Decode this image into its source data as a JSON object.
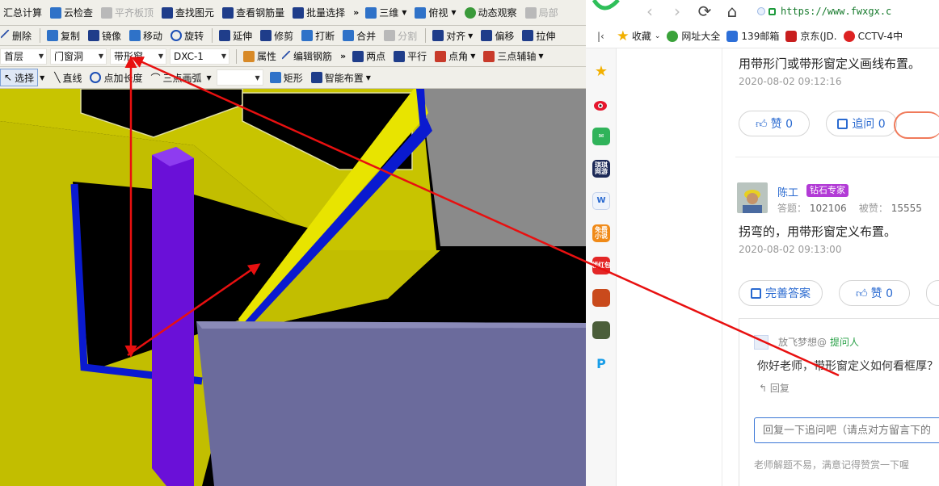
{
  "cad": {
    "toolbar1": {
      "summary": "汇总计算",
      "cloud_check": "云检查",
      "flat_slab": "平齐板顶",
      "find_element": "查找图元",
      "view_rebar": "查看钢筋量",
      "batch_select": "批量选择",
      "view_3d": "三维",
      "top_view": "俯视",
      "dynamic_view": "动态观察",
      "local": "局部"
    },
    "toolbar2": {
      "delete": "删除",
      "copy": "复制",
      "mirror": "镜像",
      "move": "移动",
      "rotate": "旋转",
      "extend": "延伸",
      "trim": "修剪",
      "break": "打断",
      "merge": "合并",
      "split": "分割",
      "align": "对齐",
      "offset": "偏移",
      "stretch": "拉伸"
    },
    "toolbar3": {
      "floor": "首层",
      "category": "门窗洞",
      "element_type": "带形窗",
      "element_name": "DXC-1",
      "properties": "属性",
      "edit_rebar": "编辑钢筋",
      "two_points": "两点",
      "parallel": "平行",
      "point_angle": "点角",
      "three_point_aux": "三点辅轴"
    },
    "toolbar4": {
      "select": "选择",
      "line": "直线",
      "point_length": "点加长度",
      "three_point_arc": "三点画弧",
      "rectangle": "矩形",
      "smart_layout": "智能布置"
    }
  },
  "browser": {
    "url": "https://www.fwxgx.c",
    "bookmarks": [
      "收藏",
      "网址大全",
      "139邮箱",
      "京东(JD.",
      "CCTV-4中"
    ],
    "rail": {
      "games": "琪琪\n网游",
      "novel": "免费\n小说",
      "hongbao": "领红包"
    },
    "answer1": {
      "text": "用带形门或带形窗定义画线布置。",
      "time": "2020-08-02 09:12:16",
      "like": "赞 0",
      "followup": "追问 0"
    },
    "answer2": {
      "user": "陈工",
      "badge": "钻石专家",
      "answers_label": "答题：",
      "answers": "102106",
      "liked_label": "被赞：",
      "liked": "15555",
      "text": "拐弯的，用带形窗定义布置。",
      "time": "2020-08-02 09:13:00",
      "improve": "完善答案",
      "like": "赞 0"
    },
    "followup": {
      "user": "放飞梦想@",
      "role": "提问人",
      "text": "你好老师，带形窗定义如何看框厚？",
      "reply": "回复",
      "input_placeholder": "回复一下追问吧（请点对方留言下的",
      "hint": "老师解题不易，满意记得赞赏一下喔"
    }
  },
  "colors": {
    "wall": "#c9c400",
    "column": "#6a10d8",
    "window_frame": "#0a1ad0",
    "slab": "#6b6b9c",
    "annotation": "#e81010"
  }
}
